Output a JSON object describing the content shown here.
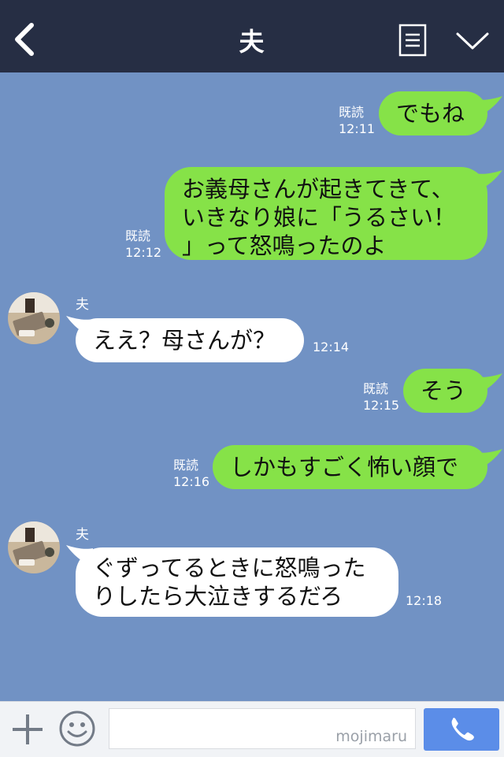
{
  "header": {
    "title": "夫",
    "icons": [
      "chevron-left-icon",
      "list-menu-icon",
      "chevron-down-icon"
    ]
  },
  "messages": [
    {
      "dir": "out",
      "lines": [
        "でもね"
      ],
      "read": "既読",
      "time": "12:11"
    },
    {
      "dir": "out",
      "lines": [
        "お義母さんが起きてきて、",
        "いきなり娘に「うるさい！",
        "」って怒鳴ったのよ"
      ],
      "read": "既読",
      "time": "12:12"
    },
    {
      "dir": "in",
      "sender": "夫",
      "lines": [
        "ええ？母さんが？"
      ],
      "time": "12:14"
    },
    {
      "dir": "out",
      "lines": [
        "そう"
      ],
      "read": "既読",
      "time": "12:15"
    },
    {
      "dir": "out",
      "lines": [
        "しかもすごく怖い顔で"
      ],
      "read": "既読",
      "time": "12:16"
    },
    {
      "dir": "in",
      "sender": "夫",
      "lines": [
        "ぐずってるときに怒鳴った",
        "りしたら大泣きするだろ"
      ],
      "time": "12:18"
    }
  ],
  "footer": {
    "watermark": "mojimaru",
    "icons": [
      "plus-icon",
      "smiley-icon",
      "phone-icon"
    ]
  },
  "colors": {
    "header_bg": "#262e44",
    "chat_bg": "#7192c4",
    "outgoing_bubble": "#86e248",
    "incoming_bubble": "#ffffff",
    "call_button": "#5b8de8"
  }
}
